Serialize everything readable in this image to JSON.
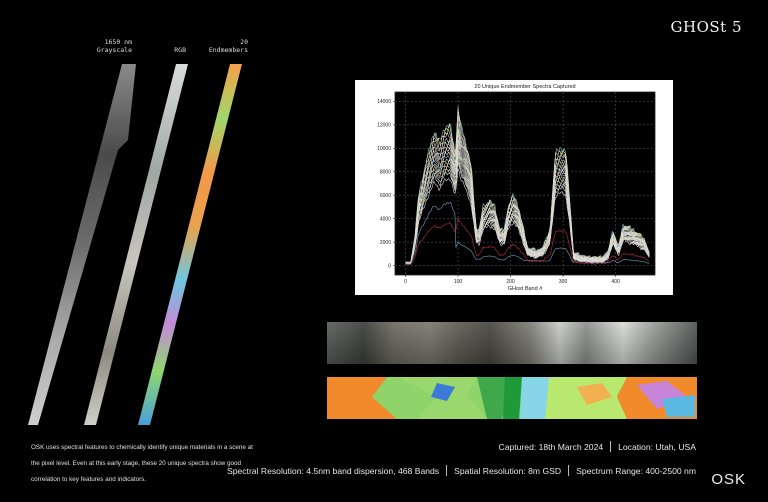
{
  "brand": "GHOSt 5",
  "strips": {
    "gray_label": "1650 nm\nGrayscale",
    "rgb_label": "RGB",
    "end_label": "20\nEndmembers"
  },
  "description": "OSK uses spectral features to chemically identify unique materials in a scene at the pixel level. Even at this early stage, these 20 unique spectra show good correlation to key features and indicators.",
  "meta": {
    "captured": "Captured: 18th March 2024",
    "location": "Location: Utah, USA",
    "spectral": "Spectral Resolution: 4.5nm band dispersion, 468 Bands",
    "spatial": "Spatial Resolution: 8m GSD",
    "range": "Spectrum Range: 400-2500 nm"
  },
  "logo": "OSK",
  "chart_data": {
    "type": "line",
    "title": "20 Unique Endmember Spectra Captured",
    "xlabel": "GHost Band #",
    "ylabel": "",
    "xlim": [
      -20,
      475
    ],
    "ylim": [
      -800,
      14800
    ],
    "x_ticks": [
      0,
      100,
      200,
      300,
      400
    ],
    "y_ticks": [
      0,
      2000,
      4000,
      6000,
      8000,
      10000,
      12000,
      14000
    ],
    "grid": true,
    "series_count": 20,
    "amplitude_scales": [
      1.0,
      0.98,
      0.95,
      0.93,
      0.9,
      0.88,
      0.86,
      0.84,
      0.82,
      0.8,
      0.78,
      0.76,
      0.74,
      0.72,
      0.7,
      0.68,
      0.66,
      0.62,
      0.45,
      0.3
    ],
    "series_colors": [
      "#7fb8d8",
      "#f2f2a0",
      "#c7e8b6",
      "#f5b8c8",
      "#a8d8e8",
      "#fde2a8",
      "#d8c8f0",
      "#b8e8d8",
      "#f0c8a0",
      "#e8e8e8",
      "#9fc8e8",
      "#f8d8b8",
      "#c8f0c8",
      "#f0b0b0",
      "#b0d0f0",
      "#e8f0a0",
      "#d0e0f0",
      "#f0d0e0",
      "#6aa6c8",
      "#c03040"
    ],
    "envelope": {
      "x": [
        0,
        10,
        18,
        25,
        40,
        55,
        65,
        75,
        85,
        95,
        100,
        105,
        112,
        125,
        135,
        140,
        148,
        160,
        170,
        180,
        188,
        195,
        205,
        215,
        225,
        232,
        240,
        250,
        262,
        275,
        285,
        295,
        305,
        312,
        320,
        335,
        350,
        365,
        375,
        385,
        395,
        405,
        415,
        425,
        440,
        455,
        465
      ],
      "y": [
        300,
        300,
        2500,
        6000,
        9000,
        11500,
        10500,
        11800,
        12000,
        9500,
        13500,
        12000,
        11000,
        8500,
        3000,
        3000,
        5000,
        5500,
        5000,
        3000,
        3000,
        5000,
        6000,
        5000,
        3000,
        1500,
        1300,
        1200,
        1500,
        3000,
        9500,
        10000,
        9800,
        6000,
        1000,
        700,
        600,
        600,
        600,
        1000,
        3000,
        1500,
        3500,
        3200,
        2800,
        2200,
        1000
      ]
    }
  }
}
